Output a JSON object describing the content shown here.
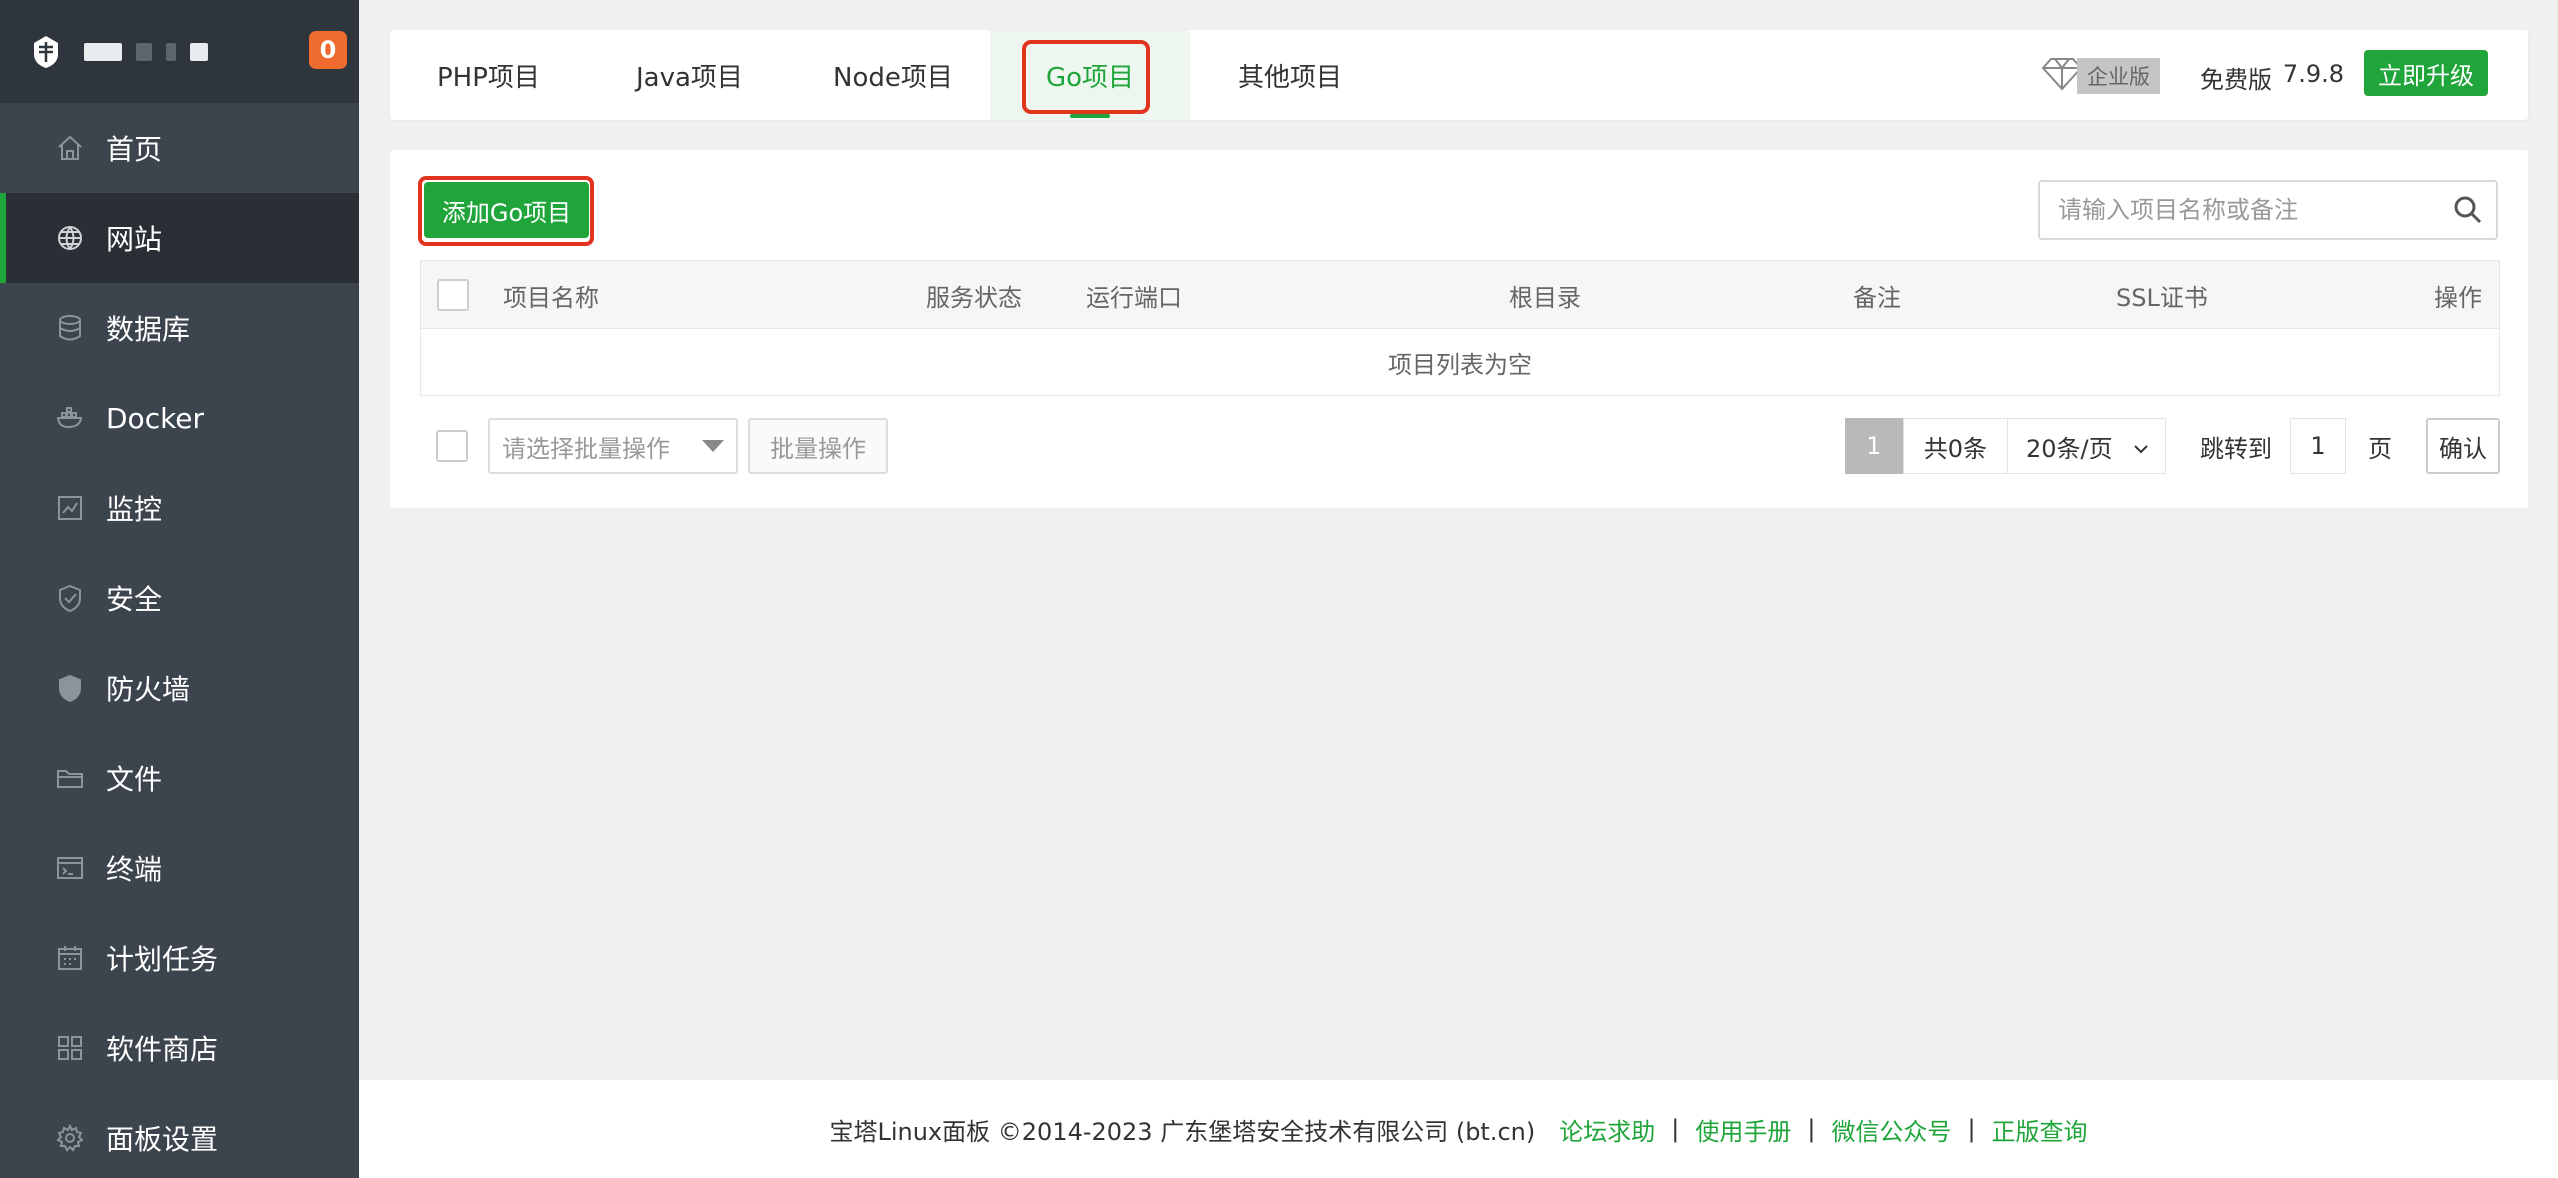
{
  "sidebar": {
    "notification_count": "0",
    "items": [
      {
        "label": "首页",
        "icon": "home-icon"
      },
      {
        "label": "网站",
        "icon": "globe-icon",
        "active": true
      },
      {
        "label": "数据库",
        "icon": "database-icon"
      },
      {
        "label": "Docker",
        "icon": "docker-icon"
      },
      {
        "label": "监控",
        "icon": "monitor-icon"
      },
      {
        "label": "安全",
        "icon": "shield-check-icon"
      },
      {
        "label": "防火墙",
        "icon": "firewall-icon"
      },
      {
        "label": "文件",
        "icon": "folder-icon"
      },
      {
        "label": "终端",
        "icon": "terminal-icon"
      },
      {
        "label": "计划任务",
        "icon": "calendar-icon"
      },
      {
        "label": "软件商店",
        "icon": "apps-icon"
      },
      {
        "label": "面板设置",
        "icon": "gear-icon"
      }
    ]
  },
  "tabs": [
    {
      "label": "PHP项目"
    },
    {
      "label": "Java项目"
    },
    {
      "label": "Node项目"
    },
    {
      "label": "Go项目",
      "active": true
    },
    {
      "label": "其他项目"
    }
  ],
  "edition": {
    "enterprise_label": "企业版",
    "free_label": "免费版",
    "version": "7.9.8",
    "upgrade_label": "立即升级"
  },
  "toolbar": {
    "add_label": "添加Go项目",
    "search_placeholder": "请输入项目名称或备注"
  },
  "table": {
    "columns": [
      "项目名称",
      "服务状态",
      "运行端口",
      "根目录",
      "备注",
      "SSL证书",
      "操作"
    ],
    "empty_text": "项目列表为空"
  },
  "batch": {
    "select_placeholder": "请选择批量操作",
    "button_label": "批量操作"
  },
  "pager": {
    "current_page": "1",
    "total": "共0条",
    "page_size": "20条/页",
    "jump_label": "跳转到",
    "jump_value": "1",
    "page_unit": "页",
    "confirm_label": "确认"
  },
  "footer": {
    "copyright": "宝塔Linux面板 ©2014-2023 广东堡塔安全技术有限公司 (bt.cn)",
    "links": [
      "论坛求助",
      "使用手册",
      "微信公众号",
      "正版查询"
    ]
  },
  "colors": {
    "accent": "#20a53a",
    "sidebar_bg": "#3c444d",
    "highlight": "#e0341f",
    "badge": "#ef6b2e"
  }
}
